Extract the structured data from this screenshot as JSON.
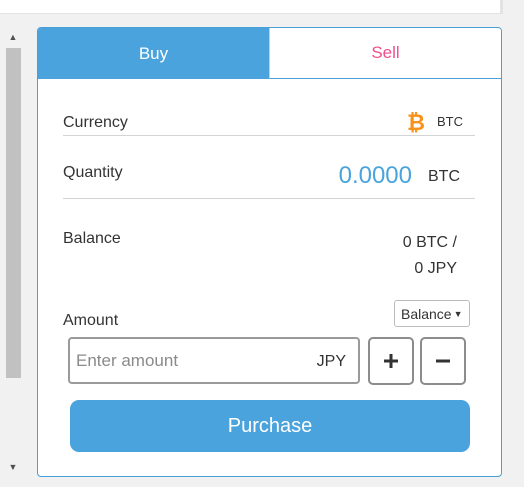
{
  "tabs": {
    "buy_label": "Buy",
    "sell_label": "Sell"
  },
  "currency": {
    "label": "Currency",
    "code": "BTC",
    "icon": "bitcoin-icon"
  },
  "quantity": {
    "label": "Quantity",
    "value": "0.0000",
    "unit": "BTC"
  },
  "balance": {
    "label": "Balance",
    "btc_text": "0 BTC /",
    "jpy_text": "0 JPY"
  },
  "amount": {
    "label": "Amount",
    "selector_label": "Balance",
    "placeholder": "Enter amount",
    "value": "",
    "unit": "JPY",
    "plus_icon": "plus-icon",
    "minus_icon": "minus-icon"
  },
  "purchase_label": "Purchase",
  "colors": {
    "accent": "#4aa3dc",
    "sell": "#ef4f8b",
    "bitcoin": "#f7931a"
  }
}
